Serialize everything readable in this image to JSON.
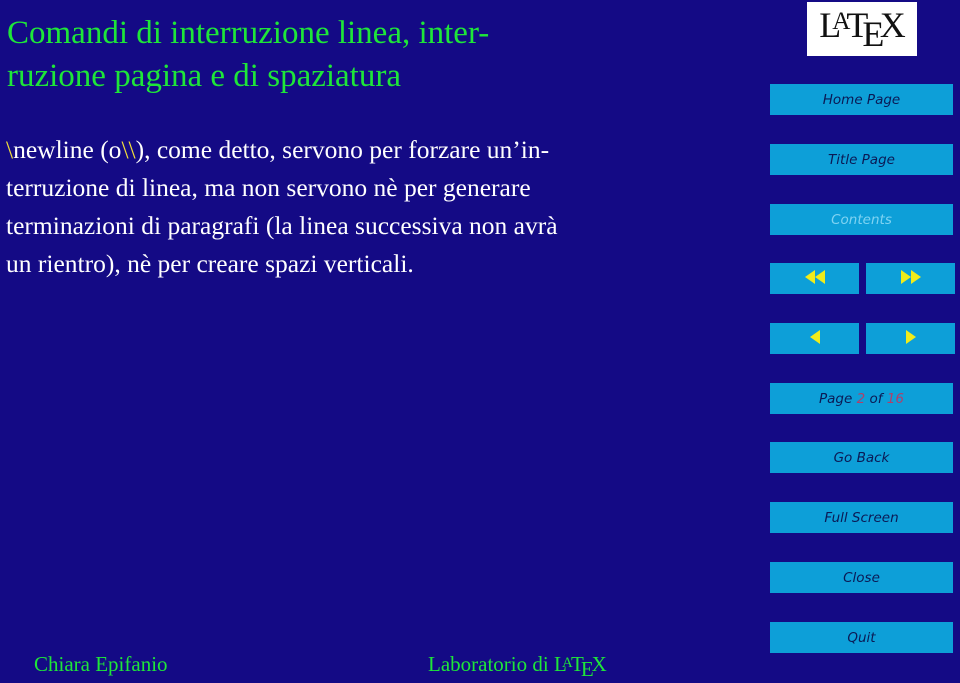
{
  "slide": {
    "title_lines": [
      "Comandi di interruzione linea, inter-",
      "ruzione pagina e di spaziatura"
    ],
    "body": {
      "line1_bs": "\\",
      "line1_a": "newline (o",
      "line1_bs2": "\\\\",
      "line1_b": "), come detto, servono per forzare un’in-",
      "line2": "terruzione di linea, ma non servono nè per generare",
      "line3": "terminazioni di paragrafi (la linea successiva non avrà",
      "line4": "un rientro), nè per creare spazi verticali."
    }
  },
  "logo": {
    "L": "L",
    "A": "A",
    "T": "T",
    "E": "E",
    "X": "X"
  },
  "nav": {
    "home": "Home Page",
    "title": "Title Page",
    "contents": "Contents",
    "first_icon": "double-left-arrow",
    "last_icon": "double-right-arrow",
    "prev_icon": "left-arrow",
    "next_icon": "right-arrow",
    "page_label": "Page",
    "page_current": "2",
    "page_of": "of",
    "page_total": "16",
    "go_back": "Go Back",
    "full_screen": "Full Screen",
    "close": "Close",
    "quit": "Quit"
  },
  "footer": {
    "author": "Chiara Epifanio",
    "course_prefix": "Laboratorio di",
    "latex": {
      "L": "L",
      "A": "A",
      "T": "T",
      "E": "E",
      "X": "X"
    }
  },
  "colors": {
    "background": "#140a85",
    "title_green": "#1ee639",
    "button_blue": "#0d9fd8",
    "arrow_yellow": "#f0ec1a",
    "backslash_yellow": "#f2dd3a",
    "page_number": "#b0406a"
  }
}
